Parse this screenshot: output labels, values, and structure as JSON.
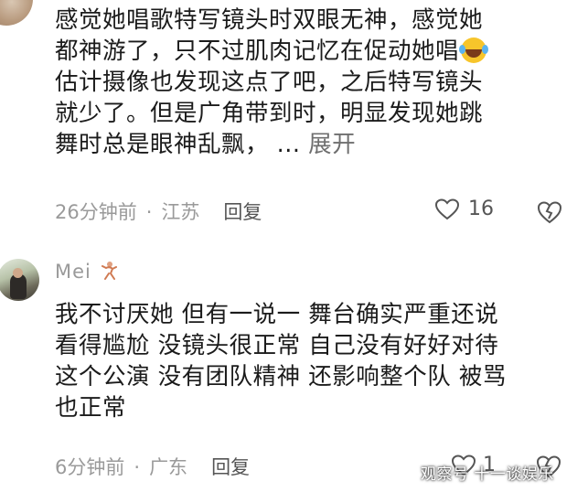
{
  "comment1": {
    "text": "感觉她唱歌特写镜头时双眼无神，感觉她\n都神游了，只不过肌肉记忆在促动她唱",
    "text_after_emoji": "\n估计摄像也发现这点了吧，之后特写镜头\n就少了。但是广角带到时，明显发现她跳\n舞时总是眼神乱飘，",
    "ellipsis": "...",
    "expand_label": "展开",
    "time": "26分钟前",
    "location": "江苏",
    "reply_label": "回复",
    "like_count": "16"
  },
  "comment2": {
    "username": "Mei",
    "text": "我不讨厌她 但有一说一 舞台确实严重还说\n看得尴尬 没镜头很正常 自己没有好好对待\n这个公演 没有团队精神 还影响整个队 被骂\n也正常",
    "time": "6分钟前",
    "location": "广东",
    "reply_label": "回复",
    "like_count": "1"
  },
  "separator": "·",
  "watermark": "观察号 十一谈娱乐",
  "icons": {
    "emoji": "laughing-tears-emoji-icon",
    "like": "heart-outline-icon",
    "dislike": "broken-heart-icon",
    "user_badge": "dancer-badge-icon"
  }
}
